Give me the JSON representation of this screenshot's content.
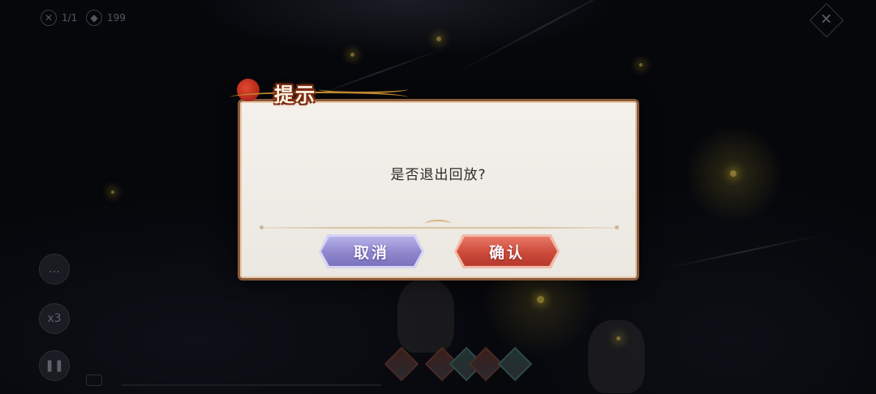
{
  "hud": {
    "counter": "1/1",
    "currency": "199",
    "speed_label": "x3",
    "pause_icon": "pause-icon",
    "close_icon": "close-icon"
  },
  "dialog": {
    "title": "提示",
    "message": "是否退出回放?",
    "cancel_label": "取消",
    "confirm_label": "确认"
  },
  "colors": {
    "dialog_border": "#8a5a3a",
    "cancel_button": "#8d86cd",
    "confirm_button": "#cc4a3a",
    "title_glow": "#d8731c"
  }
}
